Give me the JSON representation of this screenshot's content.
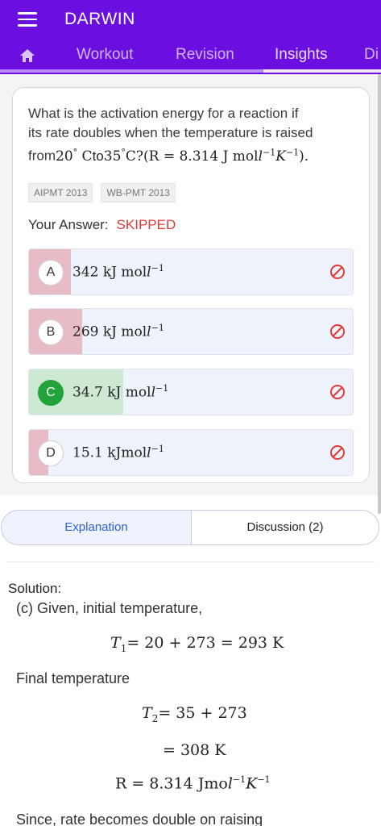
{
  "app": {
    "title": "DARWIN"
  },
  "tabs": [
    {
      "label": "Workout"
    },
    {
      "label": "Revision"
    },
    {
      "label": "Insights"
    },
    {
      "label": "Di"
    }
  ],
  "question": {
    "text_line1": "What is the activation energy for a reaction if",
    "text_line2": "its rate doubles when the temperature is raised",
    "text_from": "from",
    "t1": "20",
    "deg": "°",
    "unit_c": "C",
    "to": "to",
    "t2": "35",
    "q": "C?(R = 8.314 J mol",
    "inv": "−1",
    "k": "K",
    "close": ")."
  },
  "tags": [
    "AIPMT 2013",
    "WB-PMT 2013"
  ],
  "answer": {
    "label": "Your Answer:",
    "value": "SKIPPED"
  },
  "options": [
    {
      "letter": "A",
      "text": "342 kJ mol",
      "sup": "−1"
    },
    {
      "letter": "B",
      "text": "269 kJ mol",
      "sup": "−1"
    },
    {
      "letter": "C",
      "text": "34.7 kJ mol",
      "sup": "−1"
    },
    {
      "letter": "D",
      "text": "15.1 kJmol",
      "sup": "−1"
    }
  ],
  "option_bars": [
    {
      "fraction": 0.13,
      "color": "#e8bcc5"
    },
    {
      "fraction": 0.165,
      "color": "#e8bcc5"
    },
    {
      "fraction": 0.29,
      "color": "#cde8d3"
    },
    {
      "fraction": 0.06,
      "color": "#e8bcc5"
    }
  ],
  "explanation_tabs": {
    "left": "Explanation",
    "right": "Discussion (2)"
  },
  "solution": {
    "heading": "Solution:",
    "line1": "(c) Given, initial temperature,",
    "eq1_var": "T",
    "eq1_sub": "1",
    "eq1_rest": "= 20 + 273 = 293 K",
    "line2": "Final temperature",
    "eq2_var": "T",
    "eq2_sub": "2",
    "eq2_rest": "= 35  + 273",
    "eq3": "= 308 K",
    "eq4_a": "R = 8.314 Jmo",
    "eq4_sup": "−1",
    "eq4_k": "K",
    "eq4_ksup": "−1",
    "line3": "Since, rate becomes double on raising"
  },
  "colors": {
    "brand": "#6a0fe0",
    "skipped": "#e03b3b",
    "correct": "#21a33a",
    "link": "#2f5fd0"
  },
  "icons": [
    "menu-icon",
    "home-icon",
    "ban-icon"
  ]
}
